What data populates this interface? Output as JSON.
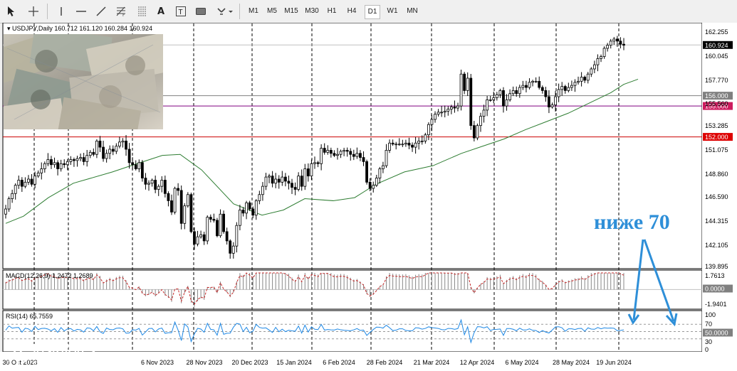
{
  "toolbar": {
    "tools": [
      "cursor-icon",
      "crosshair-icon",
      "vertical-line-icon",
      "horizontal-line-icon",
      "trendline-icon",
      "fibonacci-icon",
      "channel-icon",
      "text-icon",
      "text-label-icon",
      "rectangle-icon",
      "shapes-icon"
    ],
    "text_tool": "A",
    "text_label_tool": "T",
    "timeframes": [
      "M1",
      "M5",
      "M15",
      "M30",
      "H1",
      "H4",
      "D1",
      "W1",
      "MN"
    ],
    "active_timeframe": "D1"
  },
  "chart_data": [
    {
      "type": "line",
      "panel": "price",
      "symbol_header": "USDJPY,Daily  160.712 161.120 160.284 160.924",
      "current_price": "160.924",
      "y_ticks": [
        "162.255",
        "160.045",
        "157.770",
        "155.560",
        "153.285",
        "151.075",
        "148.860",
        "146.590",
        "144.315",
        "142.105",
        "139.895"
      ],
      "ylim": [
        139.895,
        162.255
      ],
      "horizontal_levels": [
        {
          "label": "156.000",
          "value": 156.0,
          "color": "#808080",
          "label_bg": "#808080"
        },
        {
          "label": "155.000",
          "value": 155.0,
          "color": "#800080",
          "label_bg": "#cc1b5e"
        },
        {
          "label": "152.000",
          "value": 152.0,
          "color": "#cc0000",
          "label_bg": "#dd0000"
        }
      ],
      "x_labels": [
        "30 Oct 2023",
        "6 Nov 2023",
        "28 Nov 2023",
        "20 Dec 2023",
        "15 Jan 2024",
        "6 Feb 2024",
        "28 Feb 2024",
        "21 Mar 2024",
        "12 Apr 2024",
        "6 May 2024",
        "28 May 2024",
        "19 Jun 2024"
      ],
      "closes": [
        145.0,
        146.0,
        146.5,
        147.3,
        147.8,
        147.2,
        147.6,
        147.9,
        147.4,
        148.2,
        148.5,
        148.9,
        149.4,
        149.8,
        149.3,
        149.5,
        148.9,
        149.4,
        149.3,
        149.6,
        149.8,
        149.7,
        149.9,
        150.0,
        149.6,
        150.2,
        150.5,
        150.3,
        151.6,
        151.0,
        149.9,
        150.4,
        150.8,
        150.6,
        151.1,
        151.5,
        151.6,
        150.8,
        149.5,
        149.3,
        148.9,
        149.5,
        148.0,
        147.4,
        147.5,
        147.8,
        146.9,
        147.2,
        147.8,
        146.5,
        145.8,
        144.7,
        147.0,
        146.8,
        143.6,
        145.3,
        146.4,
        142.8,
        141.6,
        142.3,
        142.5,
        141.9,
        144.2,
        144.0,
        143.9,
        142.4,
        144.5,
        142.8,
        141.9,
        140.7,
        141.4,
        143.4,
        144.9,
        144.6,
        145.6,
        145.0,
        144.4,
        145.8,
        146.4,
        147.2,
        148.1,
        148.2,
        147.5,
        147.9,
        147.6,
        148.1,
        147.7,
        147.5,
        147.1,
        146.9,
        148.2,
        147.2,
        148.9,
        148.2,
        149.4,
        149.5,
        149.4,
        150.9,
        150.5,
        150.7,
        150.4,
        150.2,
        150.3,
        150.6,
        150.7,
        150.6,
        150.3,
        150.1,
        150.4,
        150.0,
        149.6,
        147.6,
        147.0,
        147.3,
        148.0,
        148.9,
        149.2,
        150.7,
        151.4,
        151.3,
        151.3,
        151.3,
        151.3,
        151.4,
        151.2,
        151.0,
        151.4,
        151.6,
        151.6,
        152.2,
        153.2,
        153.7,
        154.2,
        154.4,
        154.4,
        154.5,
        154.7,
        154.9,
        154.8,
        155.0,
        158.1,
        156.5,
        157.7,
        153.1,
        151.9,
        153.1,
        154.0,
        154.6,
        155.6,
        155.6,
        155.8,
        156.1,
        156.5,
        155.0,
        155.6,
        156.2,
        156.5,
        156.2,
        156.8,
        157.0,
        156.8,
        157.3,
        157.4,
        157.4,
        156.8,
        156.5,
        155.9,
        154.9,
        155.1,
        155.9,
        156.6,
        156.9,
        156.5,
        156.8,
        157.0,
        157.3,
        157.4,
        157.8,
        157.5,
        158.1,
        158.6,
        159.0,
        159.6,
        159.8,
        160.6,
        160.9,
        161.3,
        161.5,
        161.3,
        161.0,
        160.9
      ],
      "ma_points": [
        [
          0,
          143.6
        ],
        [
          25,
          144.3
        ],
        [
          60,
          146.1
        ],
        [
          95,
          147.5
        ],
        [
          150,
          148.6
        ],
        [
          180,
          149.3
        ],
        [
          220,
          150.2
        ],
        [
          245,
          150.3
        ],
        [
          275,
          148.8
        ],
        [
          320,
          145.5
        ],
        [
          360,
          144.4
        ],
        [
          390,
          144.9
        ],
        [
          420,
          146.0
        ],
        [
          460,
          145.8
        ],
        [
          490,
          146.1
        ],
        [
          520,
          147.4
        ],
        [
          560,
          148.6
        ],
        [
          600,
          149.2
        ],
        [
          640,
          150.4
        ],
        [
          670,
          151.1
        ],
        [
          700,
          151.8
        ],
        [
          730,
          152.7
        ],
        [
          760,
          153.5
        ],
        [
          790,
          154.3
        ],
        [
          820,
          155.3
        ],
        [
          850,
          156.3
        ],
        [
          868,
          157.1
        ],
        [
          888,
          157.6
        ]
      ],
      "x_start": 8,
      "x_step": 4.5
    },
    {
      "type": "bar",
      "panel": "macd",
      "header": "MACD(12,26,9) 1.2472 1.2689",
      "y_ticks": [
        "1.7613",
        "0.0000",
        "-1.9401"
      ],
      "ylim": [
        -1.9401,
        1.7613
      ]
    },
    {
      "type": "line",
      "panel": "rsi",
      "header": "RSI(14) 65.7559",
      "y_ticks": [
        "100",
        "70",
        "50.0000",
        "30",
        "0"
      ],
      "ylim": [
        0,
        100
      ],
      "levels": [
        70,
        50,
        30
      ]
    }
  ],
  "annotation": {
    "text": "ниже 70",
    "color": "#2e8fd8"
  },
  "logo": {
    "name": "instaforex",
    "tagline": "Instant Forex Trading"
  }
}
